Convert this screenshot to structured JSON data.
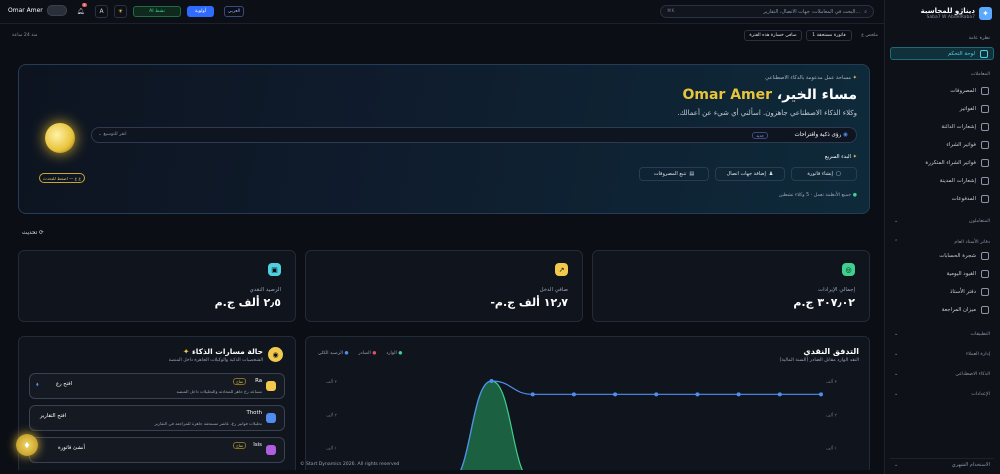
{
  "brand": {
    "title": "ديناژو للمحاسبة",
    "subtitle": "Saba7 W AbdelRaba7"
  },
  "sidebar": {
    "overview_label": "نظرة عامة",
    "dashboard": "لوحة التحكم",
    "transactions_label": "المعاملات",
    "items": [
      "المصروفات",
      "الفواتير",
      "إشعارات الدائنة",
      "فواتير الشراء",
      "فواتير الشراء المتكررة",
      "إشعارات المدينة",
      "المدفوعات"
    ],
    "contacts": "المتعاملون",
    "ledger_label": "دفاتر الأستاذ العام",
    "ledger_items": [
      "شجرة الحسابات",
      "القيود اليومية",
      "دفتر الأستاذ",
      "ميزان المراجعة"
    ],
    "apps": "التطبيقات",
    "admin": "إدارة العملاء",
    "ai": "الذكاء الاصطناعي",
    "settings": "الإعدادات",
    "footer": "الاستخدام الشهري"
  },
  "topbar": {
    "search_placeholder": "البحث في المعاملات، جهات الاتصال، التقارير...",
    "search_kbd": "⌘K",
    "lang": "العربي",
    "priority": "أولوية",
    "ai_status": "AI نشط",
    "user": "Omar Amer",
    "notif_count": "5"
  },
  "subbar": {
    "period": "منذ 24 ساعة",
    "btn1": "صافي خسارة هذه الفترة",
    "btn2": "1 فاتورة مستحقة",
    "label": "ملخص ع"
  },
  "hero": {
    "eyebrow": "مساحة عمل مدعومة بالذكاء الاصطناعي",
    "greeting": "مساء الخير،",
    "name": "Omar Amer",
    "sub": "وكلاء الذكاء الاصطناعي جاهزون. اسألني أي شيء عن أعمالك.",
    "insights": "رؤى ذكية واقتراحات",
    "insights_badge": "جديد",
    "expand": "انقر للتوسيع",
    "quick_start": "البدء السريع",
    "actions": [
      "إنشاء فاتورة",
      "إضافة جهات اتصال",
      "تتبع المصروفات"
    ],
    "status1": "جميع الأنظمة تعمل",
    "status2": "5 وكلاء نشطين",
    "orb_tag": "ع ع — اضغط للتحدث"
  },
  "refresh": "تحديث",
  "cards": [
    {
      "label": "إجمالي الإيرادات",
      "value": "٣٠٧٫٠٢ ج.م",
      "color": "#3fcf8e",
      "icon": "chart-icon"
    },
    {
      "label": "صافي الدخل",
      "value": "-١٢٫٧ ألف ج.م",
      "color": "#f2c94c",
      "icon": "trend-icon"
    },
    {
      "label": "الرصيد النقدي",
      "value": "٢٫٥ ألف ج.م",
      "color": "#4fd0e0",
      "icon": "wallet-icon"
    }
  ],
  "agents_panel": {
    "title": "حالة مسارات الذكاء",
    "sub": "الشخصيات الذكية والوكيلات الجاهزة داخل المنصة",
    "agents": [
      {
        "name": "Ra",
        "tag": "متاح",
        "desc": "مساعد رع جاهز للمحادثة والتحليلات داخل المنصة",
        "btn": "افتح رع"
      },
      {
        "name": "Thoth",
        "tag": "",
        "desc": "تحليلات فواتير رع، عاشر مستحقة جاهزة للمراجعة في التقارير",
        "btn": "افتح التقارير"
      },
      {
        "name": "Isis",
        "tag": "متاح",
        "desc": "",
        "btn": "أنشئ فاتورة"
      }
    ]
  },
  "chart_data": {
    "type": "area",
    "title": "التدفق النقدي",
    "subtitle": "النقد الوارد مقابل الصادر (السنة المالية)",
    "legend": [
      "الوارد",
      "الصادر",
      "الرصيد الكلي"
    ],
    "colors": [
      "#3fcf8e",
      "#e05260",
      "#4f8ef0"
    ],
    "yticks_left": [
      "٣ ألف",
      "٢ ألف",
      "١ ألف",
      "٠"
    ],
    "yticks_right": [
      "٣ ألف",
      "٢ ألف",
      "١ ألف",
      "٠"
    ],
    "series": [
      {
        "name": "الوارد",
        "values": [
          0,
          0,
          0,
          3000,
          0,
          0,
          0,
          0,
          0,
          0,
          0,
          0
        ]
      },
      {
        "name": "الرصيد الكلي",
        "values": [
          0,
          0,
          0,
          3000,
          2600,
          2600,
          2600,
          2600,
          2600,
          2600,
          2600,
          2600
        ]
      }
    ]
  },
  "footer": "© Start Dynamics 2026. All rights reserved"
}
